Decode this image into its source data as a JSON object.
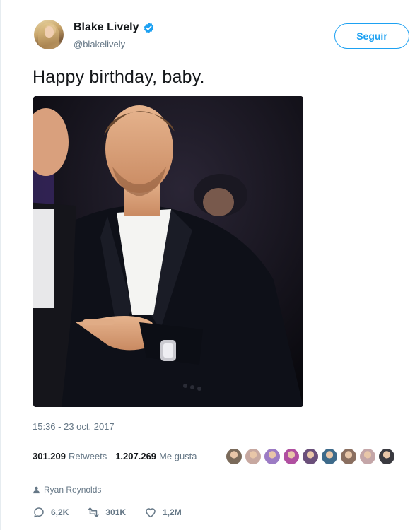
{
  "author": {
    "display_name": "Blake Lively",
    "handle": "@blakelively",
    "verified": true
  },
  "follow_button": {
    "label": "Seguir"
  },
  "tweet": {
    "text": "Happy birthday, baby.",
    "timestamp": "15:36 - 23 oct. 2017",
    "photo_icon": "photo-of-man-in-tuxedo-pointing-at-watch"
  },
  "stats": {
    "retweets_count": "301.209",
    "retweets_label": "Retweets",
    "likes_count": "1.207.269",
    "likes_label": "Me gusta"
  },
  "likers": {
    "colors": [
      "#7a6a5a",
      "#c7a8a0",
      "#9c7bc4",
      "#b04fa0",
      "#6a4f7a",
      "#3d6a8a",
      "#8a6f60",
      "#c4a6a8",
      "#3a3a40"
    ]
  },
  "reply_context": {
    "icon": "person-icon",
    "name": "Ryan Reynolds"
  },
  "actions": {
    "reply_count": "6,2K",
    "retweet_count": "301K",
    "like_count": "1,2M"
  },
  "colors": {
    "accent": "#1da1f2",
    "text_primary": "#14171a",
    "text_secondary": "#657786",
    "border": "#e6ecf0"
  }
}
